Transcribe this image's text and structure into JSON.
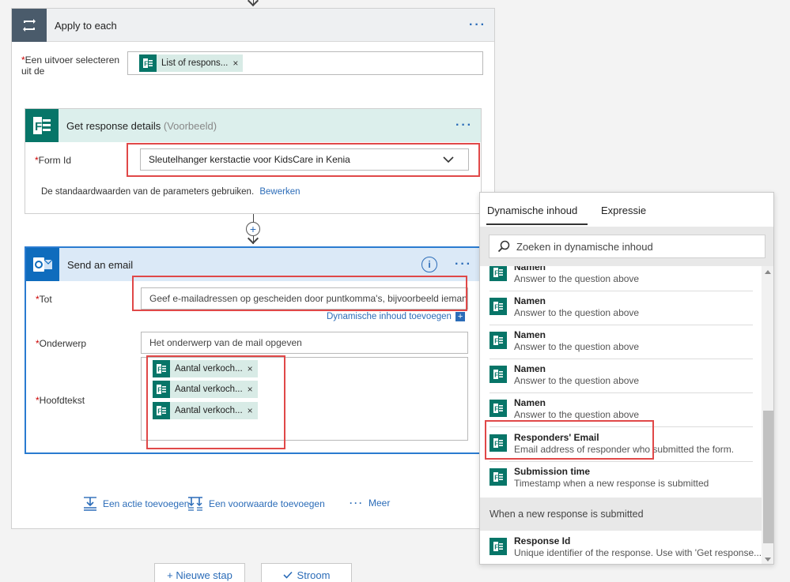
{
  "apply_to_each": {
    "title": "Apply to each",
    "select_label": "Een uitvoer selecteren uit de",
    "token": "List of respons..."
  },
  "get_response": {
    "title": "Get response details",
    "preview": "(Voorbeeld)",
    "form_id_label": "Form Id",
    "form_id_value": "Sleutelhanger kerstactie voor KidsCare in Kenia",
    "defaults_text": "De standaardwaarden van de parameters gebruiken.",
    "edit_link": "Bewerken"
  },
  "send_email": {
    "title": "Send an email",
    "to_label": "Tot",
    "to_placeholder": "Geef e-mailadressen op gescheiden door puntkomma's, bijvoorbeeld ieman...",
    "dynamic_link": "Dynamische inhoud toevoegen",
    "subject_label": "Onderwerp",
    "subject_placeholder": "Het onderwerp van de mail opgeven",
    "body_label": "Hoofdtekst",
    "body_tokens": [
      "Aantal verkoch...",
      "Aantal verkoch...",
      "Aantal verkoch..."
    ]
  },
  "footer_actions": {
    "add_action": "Een actie toevoegen",
    "add_condition": "Een voorwaarde toevoegen",
    "more": "Meer"
  },
  "bottom_buttons": {
    "new_step": "+ Nieuwe stap",
    "flow": "Stroom"
  },
  "dynamic_panel": {
    "tab_dynamic": "Dynamische inhoud",
    "tab_expression": "Expressie",
    "search_placeholder": "Zoeken in dynamische inhoud",
    "items": [
      {
        "title": "Namen",
        "subtitle": "Answer to the question above"
      },
      {
        "title": "Namen",
        "subtitle": "Answer to the question above"
      },
      {
        "title": "Namen",
        "subtitle": "Answer to the question above"
      },
      {
        "title": "Namen",
        "subtitle": "Answer to the question above"
      },
      {
        "title": "Namen",
        "subtitle": "Answer to the question above"
      },
      {
        "title": "Responders' Email",
        "subtitle": "Email address of responder who submitted the form."
      },
      {
        "title": "Submission time",
        "subtitle": "Timestamp when a new response is submitted"
      }
    ],
    "group_header": "When a new response is submitted",
    "group_items": [
      {
        "title": "Response Id",
        "subtitle": "Unique identifier of the response. Use with 'Get response..."
      }
    ]
  },
  "colors": {
    "forms_green": "#077568",
    "outlook_blue": "#0f6cbd",
    "link_blue": "#2b6cb8",
    "highlight_red": "#e04848"
  }
}
